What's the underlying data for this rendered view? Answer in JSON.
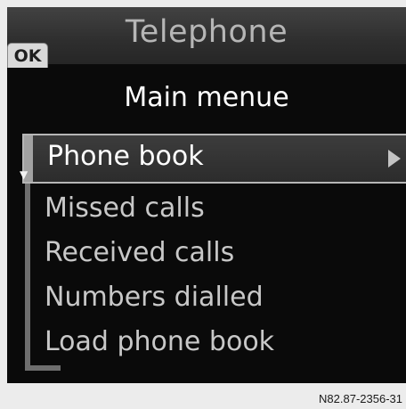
{
  "title_bar": {
    "title": "Telephone",
    "ok_label": "OK"
  },
  "menu": {
    "heading": "Main menue",
    "selected_item": "Phone book",
    "items": [
      "Missed calls",
      "Received calls",
      "Numbers dialled",
      "Load phone book"
    ]
  },
  "caption": "N82.87-2356-31",
  "colors": {
    "screen_background": "#0a0a0a",
    "title_text": "#b6b6b6",
    "selected_text": "#ffffff",
    "item_text": "#c8c8c8"
  },
  "icons": {
    "submenu": "triangle-right-icon",
    "scroll_down": "chevron-down-icon"
  }
}
